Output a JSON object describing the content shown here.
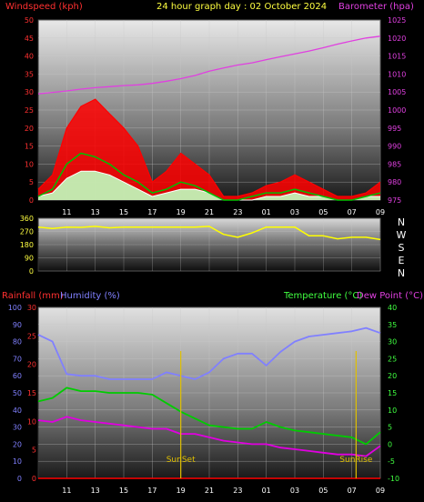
{
  "header": {
    "title": "24 hour graph day : 02 October 2024",
    "wind_label": "Windspeed (kph)",
    "baro_label": "Barometer (hpa)",
    "rain_label": "Rainfall (mm)",
    "hum_label": "Humidity (%)",
    "temp_label": "Temperature (°C)",
    "dew_label": "Dew Point (°C)"
  },
  "colors": {
    "wind": "#ff0000",
    "avg_wind": "#00c000",
    "gust_white": "#ffffff",
    "wind_light": "#c0ffc0",
    "baro": "#e040e0",
    "direction": "#ffff00",
    "humidity": "#8080ff",
    "temperature": "#00cc00",
    "dewpoint": "#e000e0",
    "rain": "#ff0000",
    "marker": "#e0c000"
  },
  "chart_data": [
    {
      "type": "line",
      "name": "wind-baro",
      "title": "24 hour graph day : 02 October 2024",
      "x_ticks": [
        "11",
        "13",
        "15",
        "17",
        "19",
        "21",
        "23",
        "01",
        "03",
        "05",
        "07",
        "09"
      ],
      "x": [
        9.0,
        10.0,
        11.0,
        12.0,
        13.0,
        14.0,
        15.0,
        16.0,
        17.0,
        18.0,
        19.0,
        20.0,
        21.0,
        22.0,
        23.0,
        24.0,
        25.0,
        26.0,
        27.0,
        28.0,
        29.0,
        30.0,
        31.0,
        32.0,
        33.0
      ],
      "left_axis": {
        "label": "Windspeed (kph)",
        "range": [
          0,
          50
        ],
        "ticks": [
          0,
          5,
          10,
          15,
          20,
          25,
          30,
          35,
          40,
          45,
          50
        ]
      },
      "right_axis": {
        "label": "Barometer (hpa)",
        "range": [
          975,
          1025
        ],
        "ticks": [
          975,
          980,
          985,
          990,
          995,
          1000,
          1005,
          1010,
          1015,
          1020,
          1025
        ]
      },
      "series": [
        {
          "key": "wind_gust",
          "axis": "left",
          "values": [
            3,
            7,
            20,
            26,
            28,
            24,
            20,
            15,
            5,
            8,
            13,
            10,
            7,
            1,
            1,
            2,
            4,
            5,
            7,
            5,
            3,
            1,
            1,
            2,
            5
          ]
        },
        {
          "key": "wind_avg",
          "axis": "left",
          "values": [
            1,
            3,
            10,
            13,
            12,
            10,
            7,
            5,
            2,
            3,
            5,
            4,
            2,
            0,
            0,
            1,
            2,
            2,
            3,
            2,
            1,
            0,
            0,
            1,
            2
          ]
        },
        {
          "key": "wind_speed",
          "axis": "left",
          "values": [
            1,
            2,
            6,
            8,
            8,
            7,
            5,
            3,
            1,
            2,
            3,
            3,
            2,
            0,
            0,
            0,
            1,
            1,
            2,
            1,
            1,
            0,
            0,
            1,
            1
          ]
        },
        {
          "key": "barometer",
          "axis": "right",
          "values": [
            1004.5,
            1004.9,
            1005.3,
            1005.8,
            1006.2,
            1006.5,
            1006.8,
            1007.0,
            1007.4,
            1008.0,
            1008.7,
            1009.6,
            1010.8,
            1011.7,
            1012.5,
            1013.1,
            1014.0,
            1014.8,
            1015.6,
            1016.4,
            1017.3,
            1018.3,
            1019.2,
            1020.0,
            1020.5
          ]
        }
      ]
    },
    {
      "type": "line",
      "name": "wind-direction",
      "x": [
        9.0,
        10.0,
        11.0,
        12.0,
        13.0,
        14.0,
        15.0,
        16.0,
        17.0,
        18.0,
        19.0,
        20.0,
        21.0,
        22.0,
        23.0,
        24.0,
        25.0,
        26.0,
        27.0,
        28.0,
        29.0,
        30.0,
        31.0,
        32.0,
        33.0
      ],
      "left_axis": {
        "range": [
          0,
          360
        ],
        "ticks": [
          0,
          90,
          180,
          270,
          360
        ]
      },
      "right_labels": [
        "N",
        "W",
        "S",
        "E",
        "N"
      ],
      "series": [
        {
          "key": "direction",
          "axis": "left",
          "values": [
            300,
            290,
            300,
            298,
            305,
            295,
            300,
            300,
            300,
            300,
            300,
            300,
            305,
            250,
            230,
            260,
            300,
            300,
            300,
            240,
            240,
            220,
            230,
            230,
            215
          ]
        }
      ]
    },
    {
      "type": "line",
      "name": "temp-hum",
      "x_ticks": [
        "11",
        "13",
        "15",
        "17",
        "19",
        "21",
        "23",
        "01",
        "03",
        "05",
        "07",
        "09"
      ],
      "x": [
        9.0,
        10.0,
        11.0,
        12.0,
        13.0,
        14.0,
        15.0,
        16.0,
        17.0,
        18.0,
        19.0,
        20.0,
        21.0,
        22.0,
        23.0,
        24.0,
        25.0,
        26.0,
        27.0,
        28.0,
        29.0,
        30.0,
        31.0,
        32.0,
        33.0
      ],
      "axes": {
        "rain": {
          "label": "Rainfall (mm)",
          "range": [
            0,
            30
          ],
          "ticks": [
            0,
            5,
            10,
            15,
            20,
            25,
            30
          ]
        },
        "humidity": {
          "label": "Humidity (%)",
          "range": [
            0,
            100
          ],
          "ticks": [
            0,
            10,
            20,
            30,
            40,
            50,
            60,
            70,
            80,
            90,
            100
          ]
        },
        "temperature": {
          "label": "Temperature (°C)",
          "range": [
            -10,
            40
          ],
          "ticks": [
            -10,
            -5,
            0,
            5,
            10,
            15,
            20,
            25,
            30,
            35,
            40
          ]
        }
      },
      "series": [
        {
          "key": "humidity",
          "axis": "humidity",
          "values": [
            84,
            80,
            61,
            60,
            60,
            58,
            58,
            58,
            58,
            62,
            60,
            58,
            62,
            70,
            73,
            73,
            66,
            74,
            80,
            83,
            84,
            85,
            86,
            88,
            85
          ]
        },
        {
          "key": "temperature",
          "axis": "temperature",
          "values": [
            12.5,
            13.5,
            16.5,
            15.5,
            15.5,
            15,
            15,
            15,
            14.5,
            12,
            9.5,
            7.5,
            5.5,
            5,
            4.5,
            4.5,
            6.5,
            5,
            4,
            3.5,
            3,
            2.5,
            2,
            0,
            3.5
          ]
        },
        {
          "key": "dewpoint",
          "axis": "temperature",
          "values": [
            7,
            6.5,
            8,
            7,
            6.5,
            6,
            5.5,
            5,
            4.5,
            4.5,
            3,
            3,
            2,
            1,
            0.5,
            0,
            0,
            -1,
            -1.5,
            -2,
            -2.5,
            -3,
            -3,
            -3.5,
            -0.5
          ]
        },
        {
          "key": "rainfall",
          "axis": "rain",
          "values": [
            0,
            0,
            0,
            0,
            0,
            0,
            0,
            0,
            0,
            0,
            0,
            0,
            0,
            0,
            0,
            0,
            0,
            0,
            0,
            0,
            0,
            0,
            0,
            0,
            0
          ]
        }
      ],
      "markers": [
        {
          "label": "SunSet",
          "x": 19.0
        },
        {
          "label": "SunRise",
          "x": 31.3
        }
      ]
    }
  ]
}
